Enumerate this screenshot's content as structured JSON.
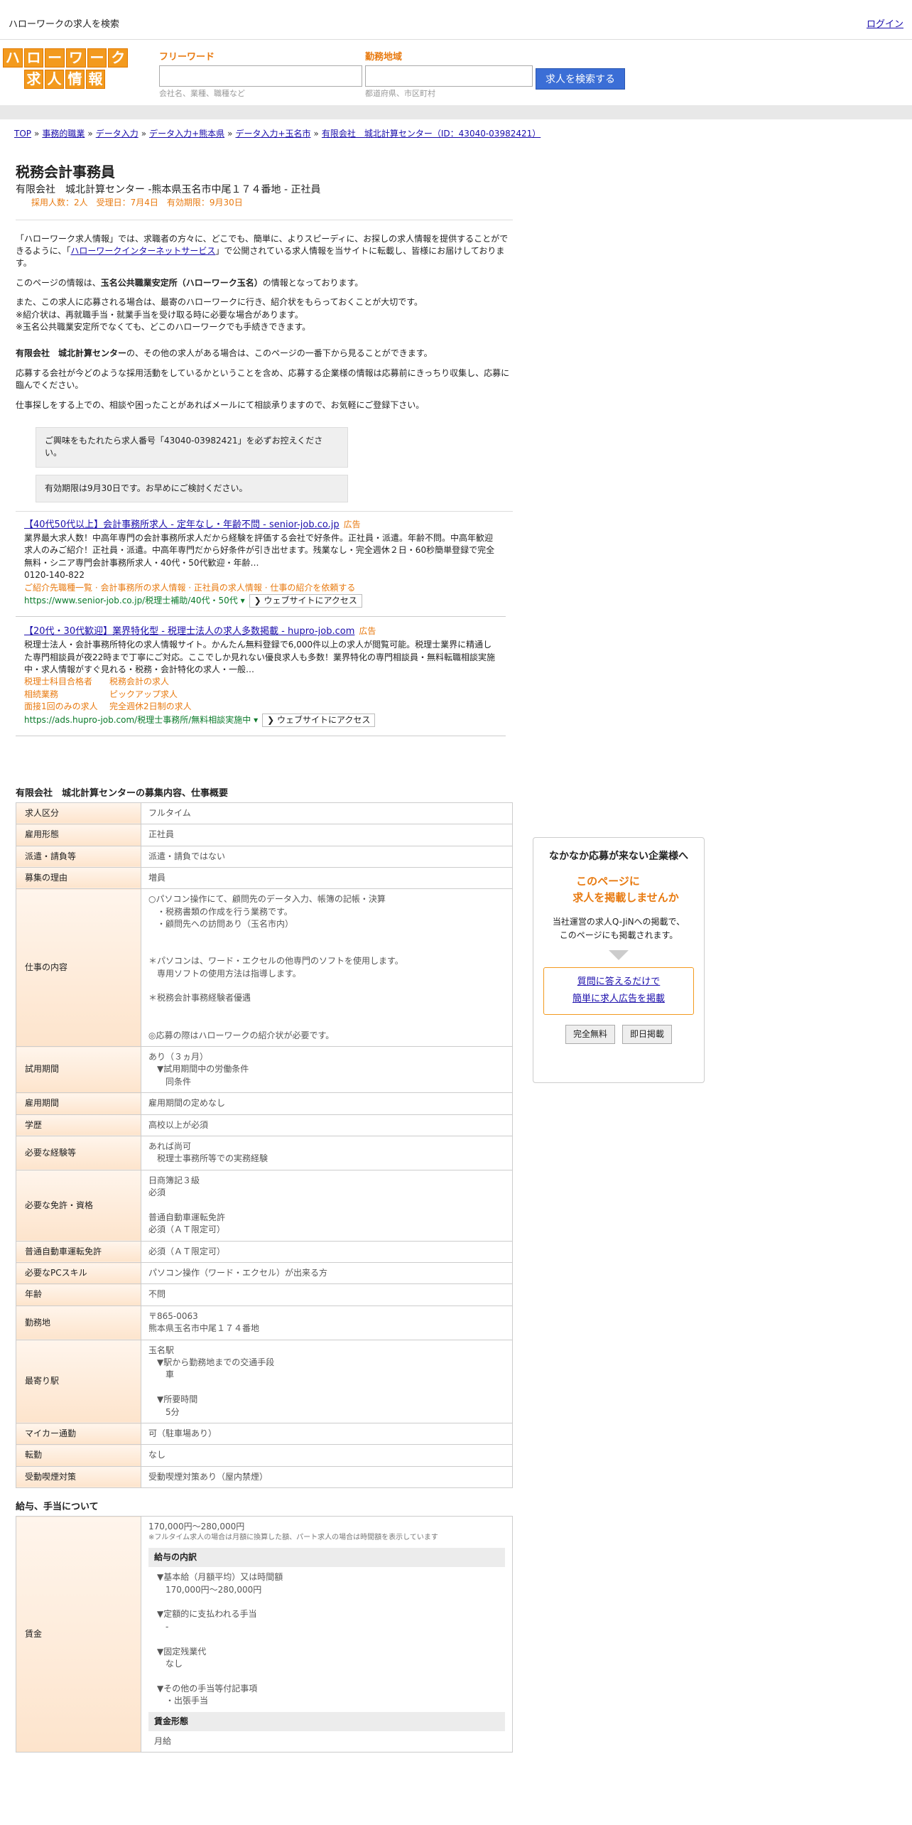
{
  "topbar": {
    "site_title": "ハローワークの求人を検索",
    "login": "ログイン"
  },
  "logo": {
    "row1": [
      "ハ",
      "ロ",
      "ー",
      "ワ",
      "ー",
      "ク"
    ],
    "row2": [
      "求",
      "人",
      "情",
      "報"
    ]
  },
  "search": {
    "keyword_label": "フリーワード",
    "keyword_hint": "会社名、業種、職種など",
    "area_label": "勤務地域",
    "area_hint": "都道府県、市区町村",
    "button": "求人を検索する"
  },
  "breadcrumbs": [
    "TOP",
    "事務的職業",
    "データ入力",
    "データ入力+熊本県",
    "データ入力+玉名市",
    "有限会社　城北計算センター（ID：43040-03982421）"
  ],
  "job": {
    "title": "税務会計事務員",
    "subtitle": "有限会社　城北計算センター -熊本県玉名市中尾１７４番地 - 正社員",
    "meta": "採用人数：2人　受理日：7月4日　有効期限：9月30日"
  },
  "intro": {
    "p1_a": "「ハローワーク求人情報」では、求職者の方々に、どこでも、簡単に、よりスピーディに、お探しの求人情報を提供することができるように、「",
    "p1_link": "ハローワークインターネットサービス",
    "p1_b": "」で公開されている求人情報を当サイトに転載し、皆様にお届けしております。",
    "p2_a": "このページの情報は、",
    "p2_bold": "玉名公共職業安定所（ハローワーク玉名）",
    "p2_b": "の情報となっております。",
    "p3_1": "また、この求人に応募される場合は、最寄のハローワークに行き、紹介状をもらっておくことが大切です。",
    "p3_2": "※紹介状は、再就職手当・就業手当を受け取る時に必要な場合があります。",
    "p3_3": "※玉名公共職業安定所でなくても、どこのハローワークでも手続きできます。",
    "p4_bold": "有限会社　城北計算センター",
    "p4_b": "の、その他の求人がある場合は、このページの一番下から見ることができます。",
    "p5": "応募する会社が今どのような採用活動をしているかということを含め、応募する企業様の情報は応募前にきっちり収集し、応募に臨んでください。",
    "p6": "仕事探しをする上での、相談や困ったことがあればメールにて相談承りますので、お気軽にご登録下さい。",
    "notice1": "ご興味をもたれたら求人番号「43040-03982421」を必ずお控えください。",
    "notice2": "有効期限は9月30日です。お早めにご検討ください。"
  },
  "ads": [
    {
      "title": "【40代50代以上】会計事務所求人 - 定年なし・年齢不問 - senior-job.co.jp",
      "label": "広告",
      "desc": "業界最大求人数！中高年専門の会計事務所求人だから経験を評価する会社で好条件。正社員・派遣。年齢不問。中高年歓迎求人のみご紹介！正社員・派遣。中高年専門だから好条件が引き出せます。残業なし・完全週休２日・60秒簡単登録で完全無料・シニア専門会計事務所求人・40代・50代歓迎・年齢…",
      "phone": "0120-140-822",
      "sublinks": "ご紹介先職種一覧 · 会計事務所の求人情報 · 正社員の求人情報 · 仕事の紹介を依頼する",
      "url": "https://www.senior-job.co.jp/税理士補助/40代・50代 ▾",
      "visit": "❯ ウェブサイトにアクセス"
    },
    {
      "title": "【20代・30代歓迎】業界特化型 - 税理士法人の求人多数掲載 - hupro-job.com",
      "label": "広告",
      "desc": "税理士法人・会計事務所特化の求人情報サイト。かんたん無料登録で6,000件以上の求人が閲覧可能。税理士業界に精通した専門相談員が夜22時まで丁寧にご対応。ここでしか見れない優良求人も多数！業界特化の専門相談員・無料転職相談実施中・求人情報がすぐ見れる・税務・会計特化の求人・一般…",
      "grid": [
        "税理士科目合格者",
        "税務会計の求人",
        "相続業務",
        "ピックアップ求人",
        "面接1回のみの求人",
        "完全週休2日制の求人"
      ],
      "url": "https://ads.hupro-job.com/税理士事務所/無料相談実施中 ▾",
      "visit": "❯ ウェブサイトにアクセス"
    }
  ],
  "details": {
    "title": "有限会社　城北計算センターの募集内容、仕事概要",
    "rows": [
      {
        "k": "求人区分",
        "v": "フルタイム"
      },
      {
        "k": "雇用形態",
        "v": "正社員"
      },
      {
        "k": "派遣・請負等",
        "v": "派遣・請負ではない"
      },
      {
        "k": "募集の理由",
        "v": "増員"
      },
      {
        "k": "仕事の内容",
        "v": "○パソコン操作にて、顧問先のデータ入力、帳簿の記帳・決算\n　・税務書類の作成を行う業務です。\n　・顧問先への訪問あり（玉名市内）\n\n\n＊パソコンは、ワード・エクセルの他専門のソフトを使用します。\n　専用ソフトの使用方法は指導します。\n\n＊税務会計事務経験者優遇\n\n\n◎応募の際はハローワークの紹介状が必要です。"
      },
      {
        "k": "試用期間",
        "v": "あり（３ヵ月）\n　▼試用期間中の労働条件\n　　同条件"
      },
      {
        "k": "雇用期間",
        "v": "雇用期間の定めなし"
      },
      {
        "k": "学歴",
        "v": "高校以上が必須"
      },
      {
        "k": "必要な経験等",
        "v": "あれば尚可\n　税理士事務所等での実務経験"
      },
      {
        "k": "必要な免許・資格",
        "v": "日商簿記３級\n必須\n\n普通自動車運転免許\n必須（ＡＴ限定可）"
      },
      {
        "k": "普通自動車運転免許",
        "v": "必須（ＡＴ限定可）"
      },
      {
        "k": "必要なPCスキル",
        "v": "パソコン操作（ワード・エクセル）が出来る方"
      },
      {
        "k": "年齢",
        "v": "不問"
      },
      {
        "k": "勤務地",
        "v": "〒865-0063\n熊本県玉名市中尾１７４番地"
      },
      {
        "k": "最寄り駅",
        "v": "玉名駅\n　▼駅から勤務地までの交通手段\n　　車\n\n　▼所要時間\n　　5分"
      },
      {
        "k": "マイカー通勤",
        "v": "可（駐車場あり）"
      },
      {
        "k": "転勤",
        "v": "なし"
      },
      {
        "k": "受動喫煙対策",
        "v": "受動喫煙対策あり（屋内禁煙）"
      }
    ]
  },
  "pay": {
    "title": "給与、手当について",
    "label": "賃金",
    "range": "170,000円〜280,000円",
    "note": "※フルタイム求人の場合は月額に換算した額、パート求人の場合は時間額を表示しています",
    "breakdown_title": "給与の内訳",
    "breakdown": "　▼基本給（月額平均）又は時間額\n　　170,000円〜280,000円\n\n　▼定額的に支払われる手当\n　　-\n\n　▼固定残業代\n　　なし\n\n　▼その他の手当等付記事項\n　　・出張手当",
    "form_title": "賃金形態",
    "form": "月給"
  },
  "sidebox": {
    "heading": "なかなか応募が来ない企業様へ",
    "catch1": "このページに",
    "catch2": "求人を掲載しませんか",
    "desc1": "当社運営の求人Q-JiNへの掲載で、",
    "desc2": "このページにも掲載されます。",
    "link1": "質問に答えるだけで",
    "link2": "簡単に求人広告を掲載",
    "btn1": "完全無料",
    "btn2": "即日掲載"
  }
}
